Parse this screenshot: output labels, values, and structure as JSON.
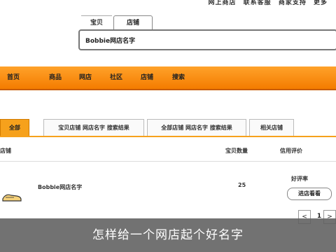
{
  "header": {
    "links": [
      "网上商店",
      "联系客服",
      "商家支持",
      "更多"
    ]
  },
  "search": {
    "tabs": [
      "宝贝",
      "店铺"
    ],
    "query": "Bobbie网店名字"
  },
  "nav": {
    "items": [
      "首页",
      "商品",
      "网店",
      "社区",
      "店铺",
      "搜索"
    ]
  },
  "category_tabs": [
    "全部",
    "宝贝店铺 网店名字 搜索结果",
    "全部店铺 网店名字 搜索结果",
    "相关店铺"
  ],
  "table": {
    "headers": [
      "店铺",
      "宝贝数量",
      "信用评价"
    ],
    "rows": [
      {
        "name": "Bobbie网店名字",
        "count": "25",
        "rating": "好评率",
        "action": "进店看看"
      }
    ]
  },
  "pager": {
    "prev": "<",
    "current": "1",
    "next": ">"
  },
  "caption": "怎样给一个网店起个好名字",
  "colors": {
    "accent": "#f68d0f",
    "caption_bg": "#5f5f5f"
  }
}
